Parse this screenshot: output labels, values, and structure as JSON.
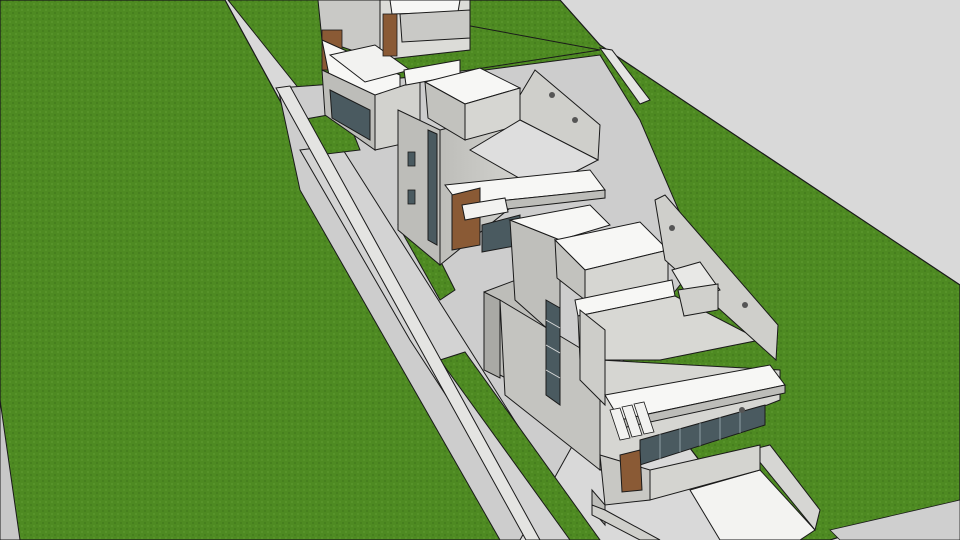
{
  "scene": {
    "kind": "3d-architectural-model",
    "houses": 3,
    "colors": {
      "sky": "#d9d9d9",
      "lawn": "#4e8a22",
      "lawn_dark": "#3f7a1a",
      "concrete": "#c9c9c6",
      "concrete_light": "#dcdcd8",
      "concrete_dark": "#a9a9a5",
      "white": "#f7f7f5",
      "paving": "#cdcdcd",
      "wood": "#8a5a35",
      "glass": "#4a5a60",
      "outline": "#1a1a1a"
    }
  }
}
